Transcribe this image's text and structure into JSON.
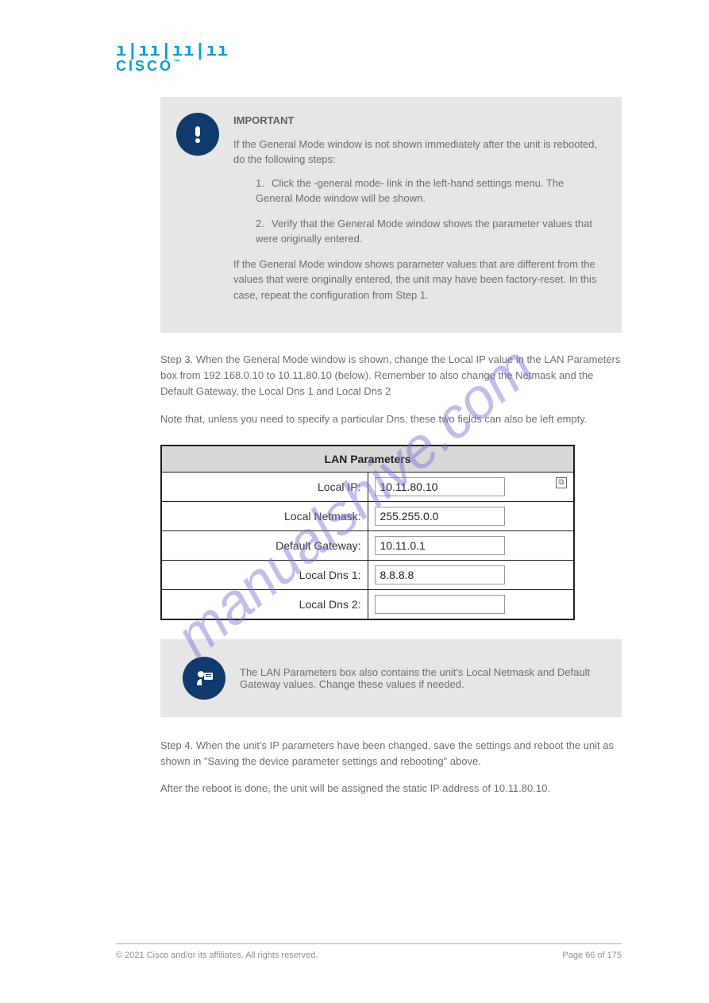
{
  "logo": {
    "name": "cisco",
    "text": "CISCO"
  },
  "important_box": {
    "title": "IMPORTANT",
    "paragraph": "If the General Mode window is not shown immediately after the unit is rebooted, do the following steps:",
    "items": [
      {
        "num": "1.",
        "text": "Click the -general mode- link in the left-hand settings menu. The General Mode window will be shown."
      },
      {
        "num": "2.",
        "text": "Verify that the General Mode window shows the parameter values that were originally entered."
      }
    ],
    "paragraph2": "If the General Mode window shows parameter values that are different from the values that were originally entered, the unit may have been factory-reset. In this case, repeat the configuration from Step 1."
  },
  "body": {
    "step3_head": "Step 3.",
    "step3_rest": " When the General Mode window is shown, change the Local IP value in the LAN Parameters box from 192.168.0.10 to 10.11.80.10 (below). Remember to also change the Netmask and the Default Gateway, the Local Dns 1 and Local Dns 2",
    "note_inline": "Note that, unless you need to specify a particular Dns, these two fields can also be left empty."
  },
  "lan": {
    "header": "LAN Parameters",
    "rows": [
      {
        "label": "Local IP:",
        "value": "10.11.80.10",
        "has_icon": true
      },
      {
        "label": "Local Netmask:",
        "value": "255.255.0.0",
        "has_icon": false
      },
      {
        "label": "Default Gateway:",
        "value": "10.11.0.1",
        "has_icon": false
      },
      {
        "label": "Local Dns 1:",
        "value": "8.8.8.8",
        "has_icon": false
      },
      {
        "label": "Local Dns 2:",
        "value": "",
        "has_icon": false
      }
    ]
  },
  "note_box": {
    "text_prefix": "The ",
    "ital": "LAN Parameters",
    "text_suffix": " box also contains the unit's Local Netmask and Default Gateway values. Change these values if needed."
  },
  "step4": {
    "head": "Step 4.",
    "rest": " When the unit's IP parameters have been changed, save the settings and reboot the unit as shown in \"Saving the device parameter settings and rebooting\" above.",
    "p2_prefix": "After the reboot is done, the unit will be assigned the static IP address of ",
    "p2_ip": "10.11.80.10"
  },
  "footer": {
    "left": "© 2021 Cisco and/or its affiliates. All rights reserved.",
    "right": "Page 66 of 175"
  },
  "watermark": "manualshive.com"
}
